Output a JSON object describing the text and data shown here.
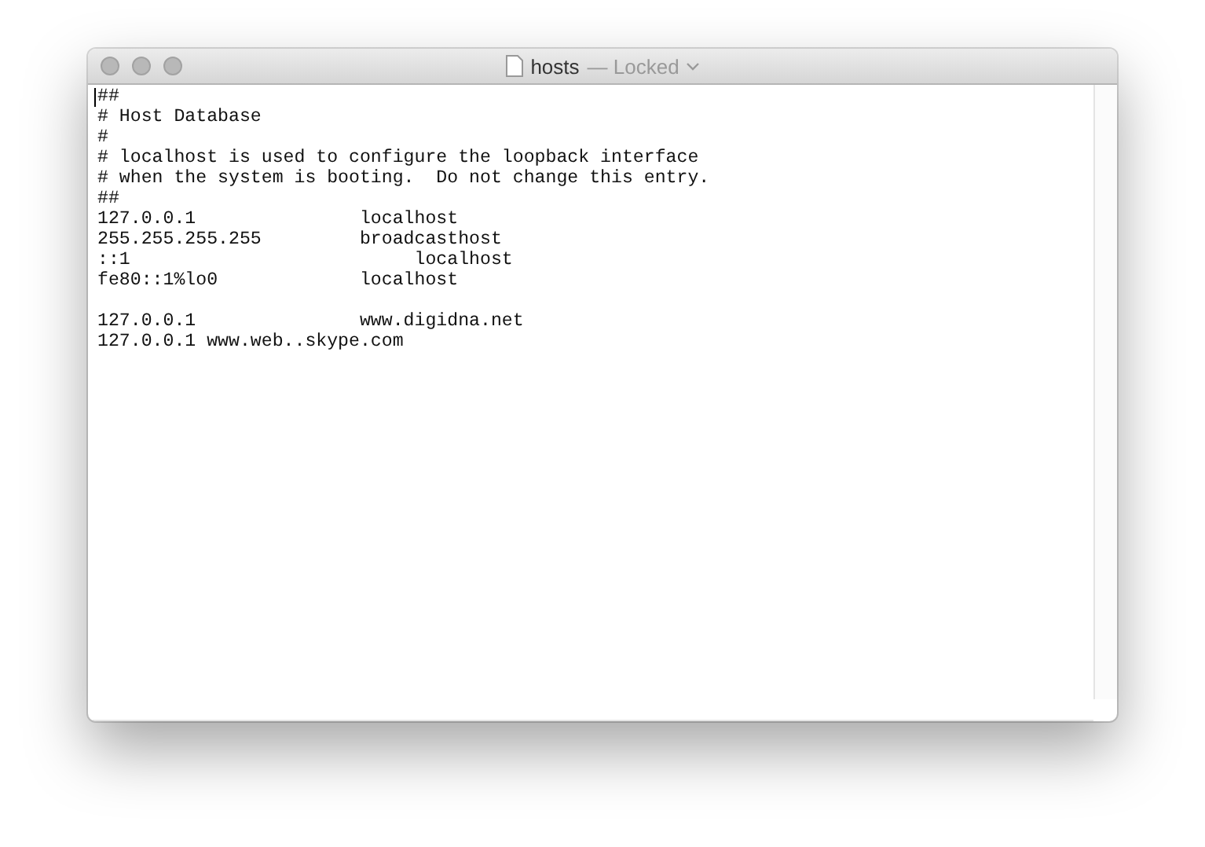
{
  "window": {
    "title": "hosts",
    "status": "— Locked"
  },
  "document": {
    "blocks": [
      [
        "##",
        "# Host Database",
        "#",
        "# localhost is used to configure the loopback interface",
        "# when the system is booting.  Do not change this entry.",
        "##",
        "127.0.0.1               localhost",
        "255.255.255.255         broadcasthost",
        "::1                          localhost",
        "fe80::1%lo0             localhost"
      ],
      [
        "127.0.0.1               www.digidna.net",
        "127.0.0.1 www.web..skype.com"
      ]
    ]
  }
}
